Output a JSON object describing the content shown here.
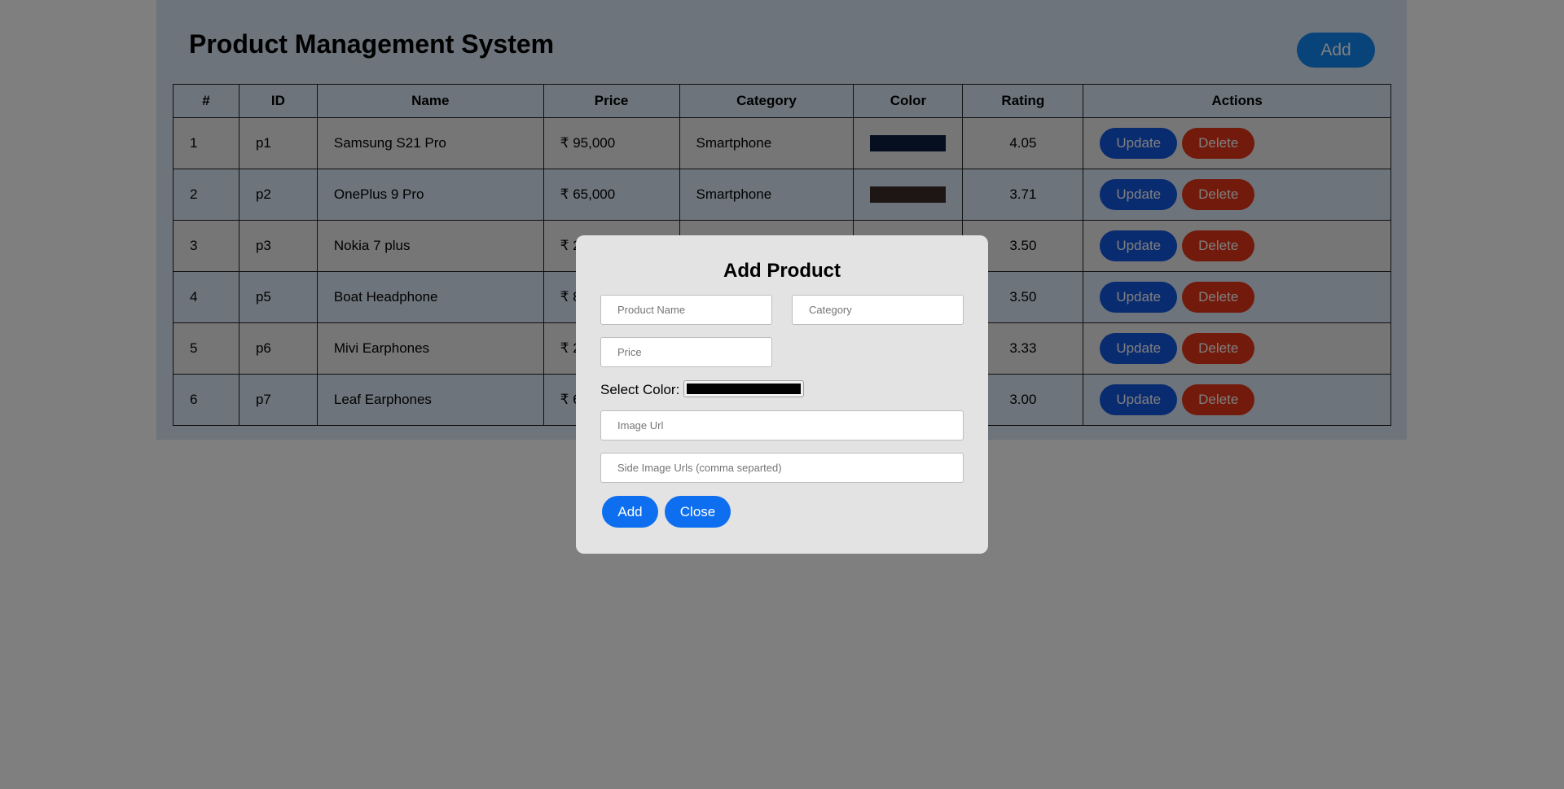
{
  "header": {
    "title": "Product Management System",
    "add_label": "Add"
  },
  "table": {
    "columns": [
      "#",
      "ID",
      "Name",
      "Price",
      "Category",
      "Color",
      "Rating",
      "Actions"
    ],
    "rows": [
      {
        "index": "1",
        "id": "p1",
        "name": "Samsung S21 Pro",
        "price": "₹ 95,000",
        "category": "Smartphone",
        "color": "#0b1f3f",
        "rating": "4.05"
      },
      {
        "index": "2",
        "id": "p2",
        "name": "OnePlus 9 Pro",
        "price": "₹ 65,000",
        "category": "Smartphone",
        "color": "#3d2a2a",
        "rating": "3.71"
      },
      {
        "index": "3",
        "id": "p3",
        "name": "Nokia 7 plus",
        "price": "₹ 2",
        "category": "",
        "color": "",
        "rating": "3.50"
      },
      {
        "index": "4",
        "id": "p5",
        "name": "Boat Headphone",
        "price": "₹ 8",
        "category": "",
        "color": "",
        "rating": "3.50"
      },
      {
        "index": "5",
        "id": "p6",
        "name": "Mivi Earphones",
        "price": "₹ 2",
        "category": "",
        "color": "",
        "rating": "3.33"
      },
      {
        "index": "6",
        "id": "p7",
        "name": "Leaf Earphones",
        "price": "₹ 6",
        "category": "",
        "color": "",
        "rating": "3.00"
      }
    ],
    "update_label": "Update",
    "delete_label": "Delete"
  },
  "modal": {
    "title": "Add Product",
    "product_name_placeholder": "Product Name",
    "category_placeholder": "Category",
    "price_placeholder": "Price",
    "color_label": "Select Color:",
    "color_value": "#000000",
    "image_url_placeholder": "Image Url",
    "side_image_placeholder": "Side Image Urls (comma separted)",
    "add_label": "Add",
    "close_label": "Close"
  },
  "colors": {
    "container_bg": "#dbe9f6",
    "accent": "#1186f3",
    "update": "#1357e0",
    "delete": "#e53517",
    "overlay": "rgba(0,0,0,0.5)"
  }
}
